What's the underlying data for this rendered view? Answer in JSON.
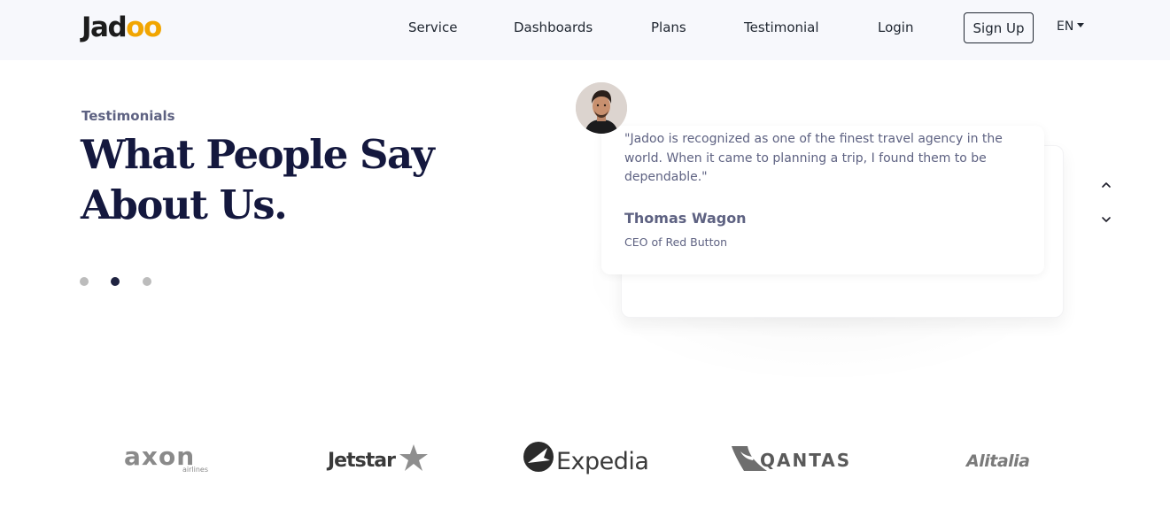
{
  "nav": {
    "logo": {
      "main": "Jad",
      "accent": "oo"
    },
    "links": [
      "Service",
      "Dashboards",
      "Plans",
      "Testimonial",
      "Login"
    ],
    "signup_label": "Sign Up",
    "language": "EN"
  },
  "testimonials": {
    "eyebrow": "Testimonials",
    "heading_line1": "What People Say",
    "heading_line2": "About Us.",
    "active_slide": 2,
    "slide_count": 3,
    "quote": "\"Jadoo is recognized as one of the finest travel agency in the world. When it came to planning a trip, I found them to be dependable.\"",
    "author_name": "Thomas Wagon",
    "author_role": "CEO of Red Button"
  },
  "partners": {
    "axon": {
      "main": "axon",
      "sub": "airlines"
    },
    "jetstar": "Jetstar",
    "expedia": "Expedia",
    "qantas": "QANTAS",
    "alitalia": "Alitalia"
  },
  "colors": {
    "heading": "#14183e",
    "body_text": "#5e6282",
    "logo_accent": "#f1a501",
    "nav_bg": "#f7f8fc"
  }
}
